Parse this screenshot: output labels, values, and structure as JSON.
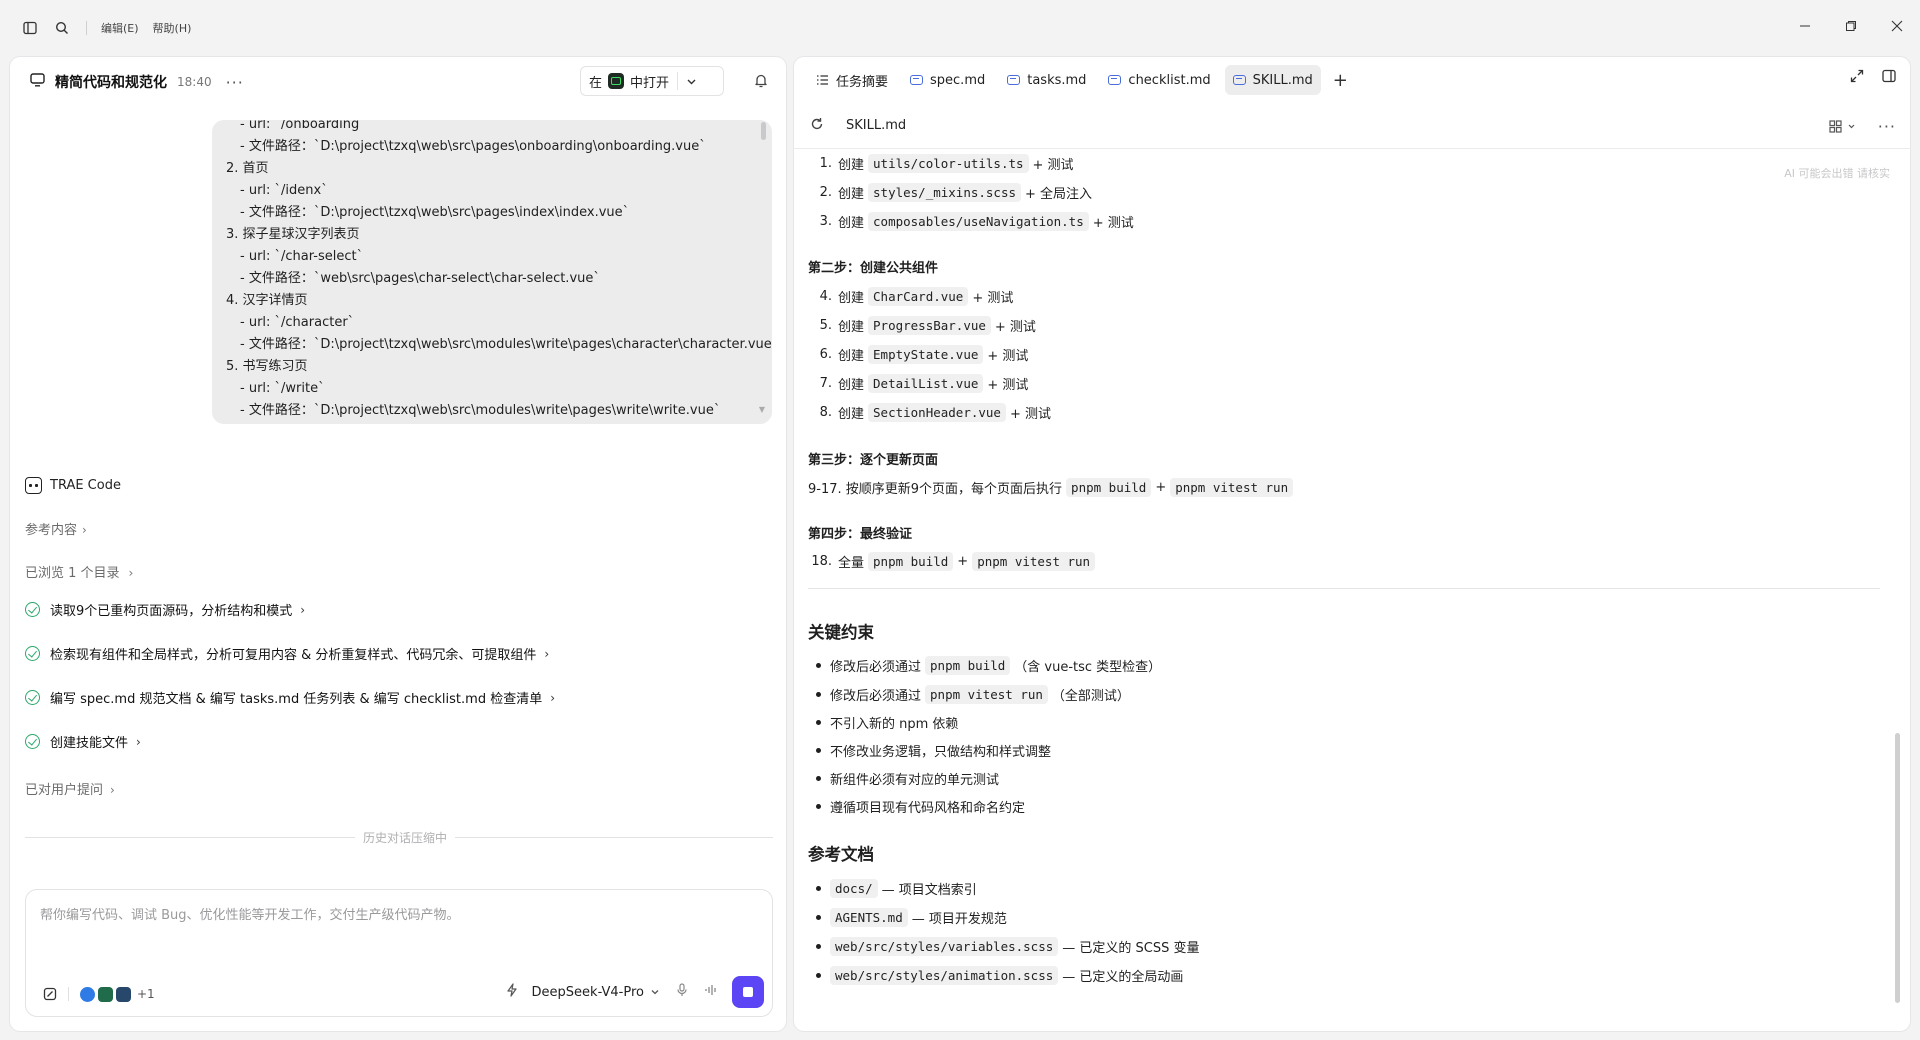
{
  "titlebar": {
    "menus": [
      "编辑(E)",
      "帮助(H)"
    ]
  },
  "left": {
    "chat_title": "精简代码和规范化",
    "chat_time": "18:40",
    "open_prefix": "在",
    "open_label": "中打开",
    "message_lines": [
      {
        "text": "- url: `/onboarding`",
        "sub": true
      },
      {
        "text": "- 文件路径：`D:\\project\\tzxq\\web\\src\\pages\\onboarding\\onboarding.vue`",
        "sub": true
      },
      {
        "text": "2. 首页",
        "sub": false
      },
      {
        "text": "- url: `/idenx`",
        "sub": true
      },
      {
        "text": "- 文件路径：`D:\\project\\tzxq\\web\\src\\pages\\index\\index.vue`",
        "sub": true
      },
      {
        "text": "3. 探子星球汉字列表页",
        "sub": false
      },
      {
        "text": "- url: `/char-select`",
        "sub": true
      },
      {
        "text": "- 文件路径：`web\\src\\pages\\char-select\\char-select.vue`",
        "sub": true
      },
      {
        "text": "4. 汉字详情页",
        "sub": false
      },
      {
        "text": "- url: `/character`",
        "sub": true
      },
      {
        "text": "- 文件路径：`D:\\project\\tzxq\\web\\src\\modules\\write\\pages\\character\\character.vue`",
        "sub": true
      },
      {
        "text": "5. 书写练习页",
        "sub": false
      },
      {
        "text": "- url: `/write`",
        "sub": true
      },
      {
        "text": "- 文件路径：`D:\\project\\tzxq\\web\\src\\modules\\write\\pages\\write\\write.vue`",
        "sub": true
      }
    ],
    "agent_name": "TRAE Code",
    "reference": "参考内容",
    "browsed": "已浏览 1 个目录",
    "tasks": [
      "读取9个已重构页面源码，分析结构和模式",
      "检索现有组件和全局样式，分析可复用内容 & 分析重复样式、代码冗余、可提取组件",
      "编写 spec.md 规范文档 & 编写 tasks.md 任务列表 & 编写 checklist.md 检查清单",
      "创建技能文件"
    ],
    "asked_user": "已对用户提问",
    "history_divider": "历史对话压缩中",
    "input_placeholder": "帮你编写代码、调试 Bug、优化性能等开发工作，交付生产级代码产物。",
    "plus_count": "+1",
    "model": "DeepSeek-V4-Pro"
  },
  "right": {
    "tabs": [
      {
        "label": "任务摘要",
        "kind": "list"
      },
      {
        "label": "spec.md",
        "kind": "md"
      },
      {
        "label": "tasks.md",
        "kind": "md"
      },
      {
        "label": "checklist.md",
        "kind": "md"
      },
      {
        "label": "SKILL.md",
        "kind": "md",
        "active": true
      }
    ],
    "file_name": "SKILL.md",
    "ai_note": "AI 可能会出错 请核实",
    "step1_items": [
      {
        "num": "1.",
        "pre": "创建",
        "code": "utils/color-utils.ts",
        "post": "+ 测试"
      },
      {
        "num": "2.",
        "pre": "创建",
        "code": "styles/_mixins.scss",
        "post": "+ 全局注入"
      },
      {
        "num": "3.",
        "pre": "创建",
        "code": "composables/useNavigation.ts",
        "post": "+ 测试"
      }
    ],
    "step2_title": "第二步：创建公共组件",
    "step2_items": [
      {
        "num": "4.",
        "pre": "创建",
        "code": "CharCard.vue",
        "post": "+ 测试"
      },
      {
        "num": "5.",
        "pre": "创建",
        "code": "ProgressBar.vue",
        "post": "+ 测试"
      },
      {
        "num": "6.",
        "pre": "创建",
        "code": "EmptyState.vue",
        "post": "+ 测试"
      },
      {
        "num": "7.",
        "pre": "创建",
        "code": "DetailList.vue",
        "post": "+ 测试"
      },
      {
        "num": "8.",
        "pre": "创建",
        "code": "SectionHeader.vue",
        "post": "+ 测试"
      }
    ],
    "step3_title": "第三步：逐个更新页面",
    "step3_line": {
      "pre": "9-17. 按顺序更新9个页面，每个页面后执行",
      "code1": "pnpm build",
      "mid": "+",
      "code2": "pnpm vitest run"
    },
    "step4_title": "第四步：最终验证",
    "step4_item": {
      "num": "18.",
      "pre": "全量",
      "code1": "pnpm build",
      "mid": "+",
      "code2": "pnpm vitest run"
    },
    "constraints_title": "关键约束",
    "constraints": [
      {
        "pre": "修改后必须通过",
        "code": "pnpm build",
        "post": "（含 vue-tsc 类型检查）"
      },
      {
        "pre": "修改后必须通过",
        "code": "pnpm vitest run",
        "post": "（全部测试）"
      },
      {
        "pre": "不引入新的 npm 依赖",
        "code": "",
        "post": ""
      },
      {
        "pre": "不修改业务逻辑，只做结构和样式调整",
        "code": "",
        "post": ""
      },
      {
        "pre": "新组件必须有对应的单元测试",
        "code": "",
        "post": ""
      },
      {
        "pre": "遵循项目现有代码风格和命名约定",
        "code": "",
        "post": ""
      }
    ],
    "refs_title": "参考文档",
    "refs": [
      {
        "code": "docs/",
        "post": "— 项目文档索引"
      },
      {
        "code": "AGENTS.md",
        "post": "— 项目开发规范"
      },
      {
        "code": "web/src/styles/variables.scss",
        "post": "— 已定义的 SCSS 变量"
      },
      {
        "code": "web/src/styles/animation.scss",
        "post": "— 已定义的全局动画"
      }
    ]
  }
}
